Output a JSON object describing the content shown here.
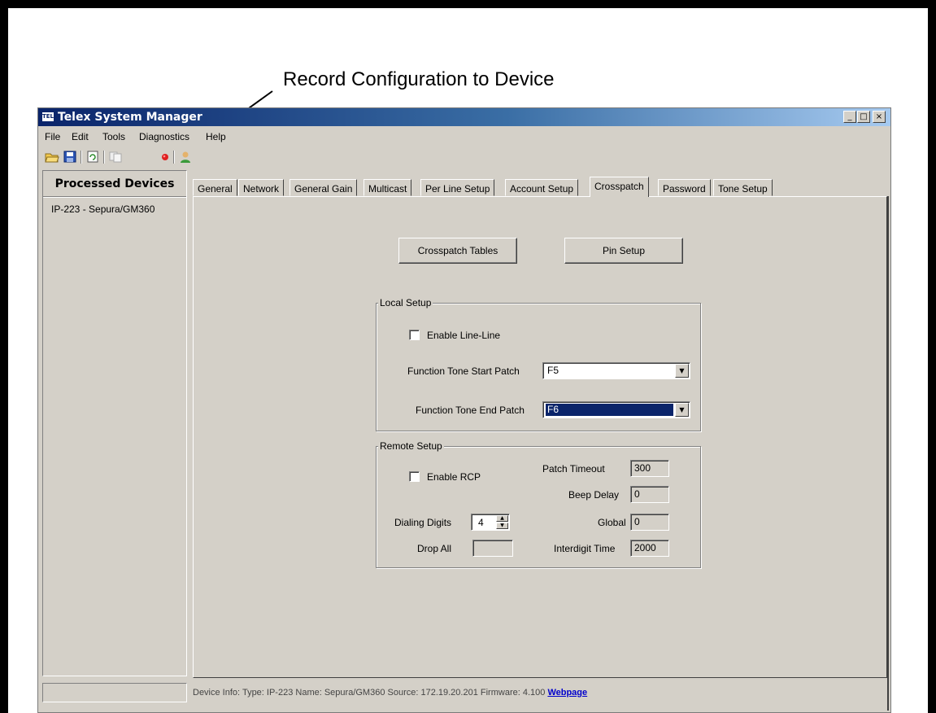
{
  "annotation": {
    "text": "Record Configuration to Device"
  },
  "window": {
    "title": "Telex System Manager",
    "icon_label": "TELEX",
    "controls": {
      "minimize": "_",
      "maximize": "□",
      "close": "×"
    }
  },
  "menu": {
    "items": [
      "File",
      "Edit",
      "Tools",
      "Diagnostics",
      "Help"
    ]
  },
  "toolbar": {
    "buttons": [
      "open-icon",
      "save-icon",
      "refresh-icon",
      "copy-icon",
      "record-icon",
      "user-icon"
    ]
  },
  "sidebar": {
    "header": "Processed Devices",
    "items": [
      "IP-223 - Sepura/GM360"
    ]
  },
  "tabs": [
    {
      "label": "General",
      "active": false
    },
    {
      "label": "Network",
      "active": false
    },
    {
      "label": "General Gain",
      "active": false
    },
    {
      "label": "Multicast",
      "active": false
    },
    {
      "label": "Per Line Setup",
      "active": false
    },
    {
      "label": "Account Setup",
      "active": false
    },
    {
      "label": "Crosspatch",
      "active": true
    },
    {
      "label": "Password",
      "active": false
    },
    {
      "label": "Tone Setup",
      "active": false
    }
  ],
  "crosspatch": {
    "crosspatch_tables_button": "Crosspatch Tables",
    "pin_setup_button": "Pin Setup",
    "local_setup": {
      "title": "Local Setup",
      "enable_line_line": {
        "label": "Enable Line-Line",
        "checked": false
      },
      "start_patch": {
        "label": "Function Tone Start Patch",
        "value": "F5"
      },
      "end_patch": {
        "label": "Function Tone End Patch",
        "value": "F6"
      }
    },
    "remote_setup": {
      "title": "Remote Setup",
      "enable_rcp": {
        "label": "Enable RCP",
        "checked": false
      },
      "dialing_digits": {
        "label": "Dialing Digits",
        "value": "4"
      },
      "drop_all": {
        "label": "Drop All",
        "value": ""
      },
      "patch_timeout": {
        "label": "Patch Timeout",
        "value": "300"
      },
      "beep_delay": {
        "label": "Beep Delay",
        "value": "0"
      },
      "global": {
        "label": "Global",
        "value": "0"
      },
      "interdigit_time": {
        "label": "Interdigit Time",
        "value": "2000"
      }
    }
  },
  "status": {
    "prefix": "Device Info:",
    "type": "Type: IP-223",
    "name": "Name: Sepura/GM360",
    "source": "Source: 172.19.20.201",
    "firmware": "Firmware: 4.100",
    "link": "Webpage"
  }
}
